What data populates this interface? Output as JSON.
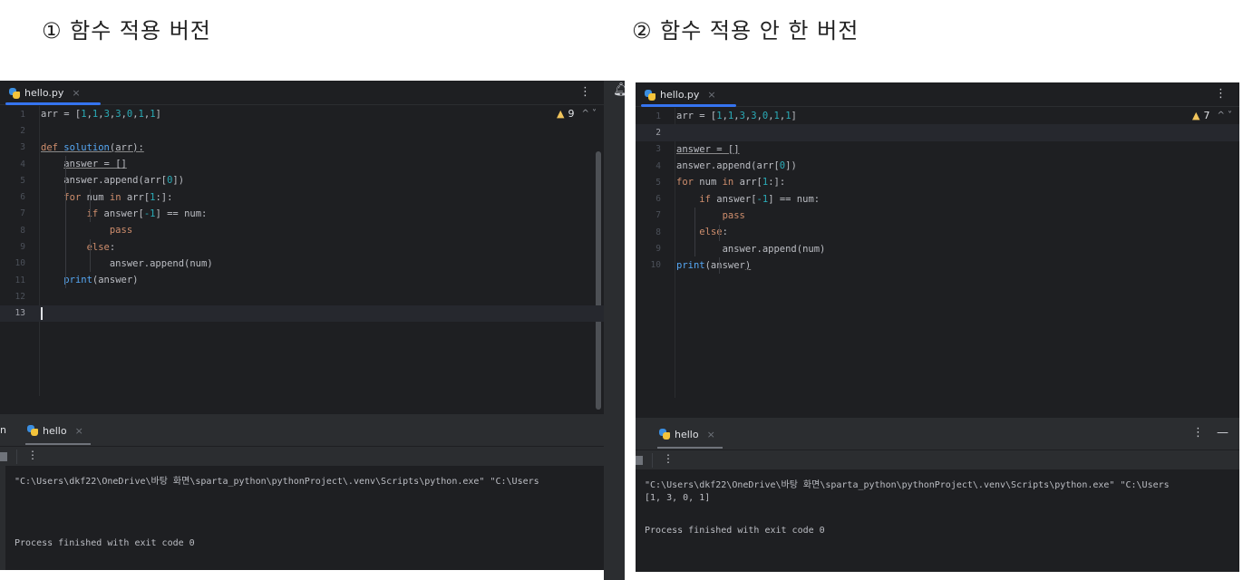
{
  "headings": {
    "left": "① 함수 적용 버전",
    "right": "② 함수 적용 안 한 버전"
  },
  "colors": {
    "background": "#1e1f22",
    "panel": "#2b2d30",
    "keyword": "#cf8e6d",
    "function": "#56a8f5",
    "number": "#2aacb8",
    "accent_tab": "#3574f0",
    "warning": "#f2c55c"
  },
  "left_ide": {
    "tab": {
      "icon": "python-file-icon",
      "label": "hello.py",
      "close": "×"
    },
    "menu": "⋮",
    "warnings": {
      "icon": "warning-icon",
      "count": "9",
      "nav": "^ ˅"
    },
    "lines": [
      {
        "n": "1",
        "segments": [
          [
            "plain",
            "arr = ["
          ],
          [
            "num",
            "1"
          ],
          [
            "plain",
            ","
          ],
          [
            "num",
            "1"
          ],
          [
            "plain",
            ","
          ],
          [
            "num",
            "3"
          ],
          [
            "plain",
            ","
          ],
          [
            "num",
            "3"
          ],
          [
            "plain",
            ","
          ],
          [
            "num",
            "0"
          ],
          [
            "plain",
            ","
          ],
          [
            "num",
            "1"
          ],
          [
            "plain",
            ","
          ],
          [
            "num",
            "1"
          ],
          [
            "plain",
            "]"
          ]
        ]
      },
      {
        "n": "2",
        "segments": []
      },
      {
        "n": "3",
        "segments": [
          [
            "kw ul",
            "def "
          ],
          [
            "fn ul",
            "solution"
          ],
          [
            "plain ul",
            "(arr):"
          ]
        ]
      },
      {
        "n": "4",
        "segments": [
          [
            "plain",
            "    "
          ],
          [
            "plain ul",
            "answer = []"
          ]
        ]
      },
      {
        "n": "5",
        "segments": [
          [
            "plain",
            "    answer.append(arr["
          ],
          [
            "num",
            "0"
          ],
          [
            "plain",
            "])"
          ]
        ]
      },
      {
        "n": "6",
        "segments": [
          [
            "plain",
            "    "
          ],
          [
            "kw",
            "for "
          ],
          [
            "plain",
            "num "
          ],
          [
            "kw",
            "in "
          ],
          [
            "plain",
            "arr["
          ],
          [
            "num",
            "1"
          ],
          [
            "plain",
            ":]:"
          ]
        ]
      },
      {
        "n": "7",
        "segments": [
          [
            "plain",
            "        "
          ],
          [
            "kw",
            "if "
          ],
          [
            "plain",
            "answer["
          ],
          [
            "num",
            "-1"
          ],
          [
            "plain",
            "] == num:"
          ]
        ]
      },
      {
        "n": "8",
        "segments": [
          [
            "plain",
            "            "
          ],
          [
            "kw",
            "pass"
          ]
        ]
      },
      {
        "n": "9",
        "segments": [
          [
            "plain",
            "        "
          ],
          [
            "kw",
            "else"
          ],
          [
            "plain",
            ":"
          ]
        ]
      },
      {
        "n": "10",
        "segments": [
          [
            "plain",
            "            answer.append(num)"
          ]
        ]
      },
      {
        "n": "11",
        "segments": [
          [
            "plain",
            "    "
          ],
          [
            "fn",
            "print"
          ],
          [
            "plain",
            "(answer)"
          ]
        ]
      },
      {
        "n": "12",
        "segments": []
      },
      {
        "n": "13",
        "segments": [],
        "current": true,
        "caret": true
      }
    ],
    "run": {
      "side_label": "n",
      "tab_label": "hello",
      "close": "×",
      "toolbar_menu": "⋮",
      "console": [
        "\"C:\\Users\\dkf22\\OneDrive\\바탕 화면\\sparta_python\\pythonProject\\.venv\\Scripts\\python.exe\" \"C:\\Users",
        "",
        "Process finished with exit code 0"
      ]
    }
  },
  "right_ide": {
    "tab": {
      "icon": "python-file-icon",
      "label": "hello.py",
      "close": "×"
    },
    "menu": "⋮",
    "warnings": {
      "icon": "warning-icon",
      "count": "7",
      "nav": "^ ˅"
    },
    "lines": [
      {
        "n": "1",
        "segments": [
          [
            "plain",
            "arr = ["
          ],
          [
            "num",
            "1"
          ],
          [
            "plain",
            ","
          ],
          [
            "num",
            "1"
          ],
          [
            "plain",
            ","
          ],
          [
            "num",
            "3"
          ],
          [
            "plain",
            ","
          ],
          [
            "num",
            "3"
          ],
          [
            "plain",
            ","
          ],
          [
            "num",
            "0"
          ],
          [
            "plain",
            ","
          ],
          [
            "num",
            "1"
          ],
          [
            "plain",
            ","
          ],
          [
            "num",
            "1"
          ],
          [
            "plain",
            "]"
          ]
        ]
      },
      {
        "n": "2",
        "segments": [],
        "current": true
      },
      {
        "n": "3",
        "segments": [
          [
            "plain ul",
            "answer = []"
          ]
        ]
      },
      {
        "n": "4",
        "segments": [
          [
            "plain",
            "answer.append(arr["
          ],
          [
            "num",
            "0"
          ],
          [
            "plain",
            "])"
          ]
        ]
      },
      {
        "n": "5",
        "segments": [
          [
            "kw",
            "for "
          ],
          [
            "plain",
            "num "
          ],
          [
            "kw",
            "in "
          ],
          [
            "plain",
            "arr["
          ],
          [
            "num",
            "1"
          ],
          [
            "plain",
            ":]:"
          ]
        ]
      },
      {
        "n": "6",
        "segments": [
          [
            "plain",
            "    "
          ],
          [
            "kw",
            "if "
          ],
          [
            "plain",
            "answer["
          ],
          [
            "num",
            "-1"
          ],
          [
            "plain",
            "] == num:"
          ]
        ]
      },
      {
        "n": "7",
        "segments": [
          [
            "plain",
            "        "
          ],
          [
            "kw",
            "pass"
          ]
        ]
      },
      {
        "n": "8",
        "segments": [
          [
            "plain",
            "    "
          ],
          [
            "kw",
            "else"
          ],
          [
            "plain",
            ":"
          ]
        ]
      },
      {
        "n": "9",
        "segments": [
          [
            "plain",
            "        answer.append(num)"
          ]
        ]
      },
      {
        "n": "10",
        "segments": [
          [
            "fn",
            "print"
          ],
          [
            "plain",
            "(answer"
          ],
          [
            "plain ul",
            ")"
          ]
        ]
      }
    ],
    "run": {
      "tab_label": "hello",
      "close": "×",
      "actions": [
        "⋮",
        "—"
      ],
      "toolbar_menu": "⋮",
      "console": [
        "\"C:\\Users\\dkf22\\OneDrive\\바탕 화면\\sparta_python\\pythonProject\\.venv\\Scripts\\python.exe\" \"C:\\Users",
        "[1, 3, 0, 1]",
        "",
        "Process finished with exit code 0"
      ]
    }
  },
  "divider": {
    "bell_icon": "notification-bell-icon",
    "bell": "🔔"
  }
}
